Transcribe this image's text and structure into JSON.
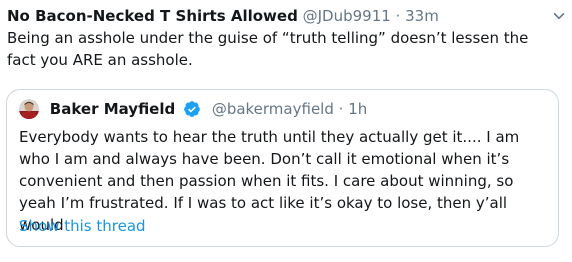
{
  "tweet": {
    "author_name": "No Bacon-Necked T Shirts Allowed",
    "author_handle": "@JDub9911",
    "separator": "·",
    "timestamp": "33m",
    "menu_icon": "chevron-down-icon",
    "text": "Being an asshole under the guise of “truth telling” doesn’t lessen the fact you ARE an asshole."
  },
  "quoted_tweet": {
    "avatar_icon": "avatar",
    "author_name": "Baker Mayfield",
    "verified_icon": "verified-badge-icon",
    "author_handle": "@bakermayfield",
    "separator": "·",
    "timestamp": "1h",
    "text": "Everybody wants to hear the truth until they actually get it.... I am who I am and always have been. Don’t call it emotional when it’s convenient and then passion when it fits. I care about winning, so yeah I’m frustrated. If I was to act like it’s okay to lose, then y’all would",
    "show_thread_label": "Show this thread"
  },
  "colors": {
    "text_primary": "#14171a",
    "text_secondary": "#657786",
    "link": "#1b95e0",
    "verified": "#1da1f2",
    "border": "#ccd6dd"
  }
}
